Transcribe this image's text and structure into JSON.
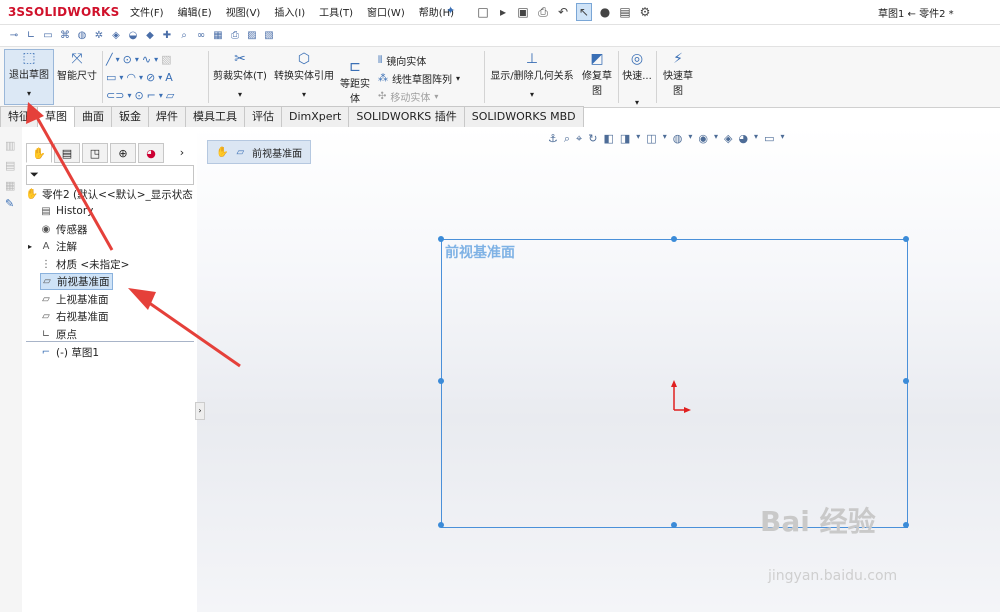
{
  "app": {
    "brand": "SOLIDWORKS",
    "document_title": "草图1 ← 零件2 *"
  },
  "menu": [
    "文件(F)",
    "编辑(E)",
    "视图(V)",
    "插入(I)",
    "工具(T)",
    "窗口(W)",
    "帮助(H)"
  ],
  "commands": {
    "exit_sketch": "退出草图",
    "smart_dimension": "智能尺寸",
    "trim": "剪裁实体(T)",
    "convert": "转换实体引用",
    "offset": "等距实体",
    "mirror": "镜向实体",
    "linear_pattern": "线性草图阵列",
    "move": "移动实体",
    "display_relations": "显示/删除几何关系",
    "repair": "修复草图",
    "quick_snaps": "快速...",
    "rapid_sketch": "快速草图"
  },
  "tabs": [
    "特征",
    "草图",
    "曲面",
    "钣金",
    "焊件",
    "模具工具",
    "评估",
    "DimXpert",
    "SOLIDWORKS 插件",
    "SOLIDWORKS MBD"
  ],
  "active_tab": "草图",
  "tree": {
    "root": "零件2 (默认<<默认>_显示状态",
    "items": [
      "History",
      "传感器",
      "注解",
      "材质 <未指定>",
      "前视基准面",
      "上视基准面",
      "右视基准面",
      "原点",
      "(-) 草图1"
    ],
    "selected": "前视基准面"
  },
  "breadcrumb": "前视基准面",
  "plane_label": "前视基准面",
  "watermark": {
    "main": "Bai 经验",
    "sub": "jingyan.baidu.com"
  },
  "colors": {
    "accent": "#3b8bd8",
    "brand": "#d0112b",
    "arrow": "#e5403a"
  }
}
